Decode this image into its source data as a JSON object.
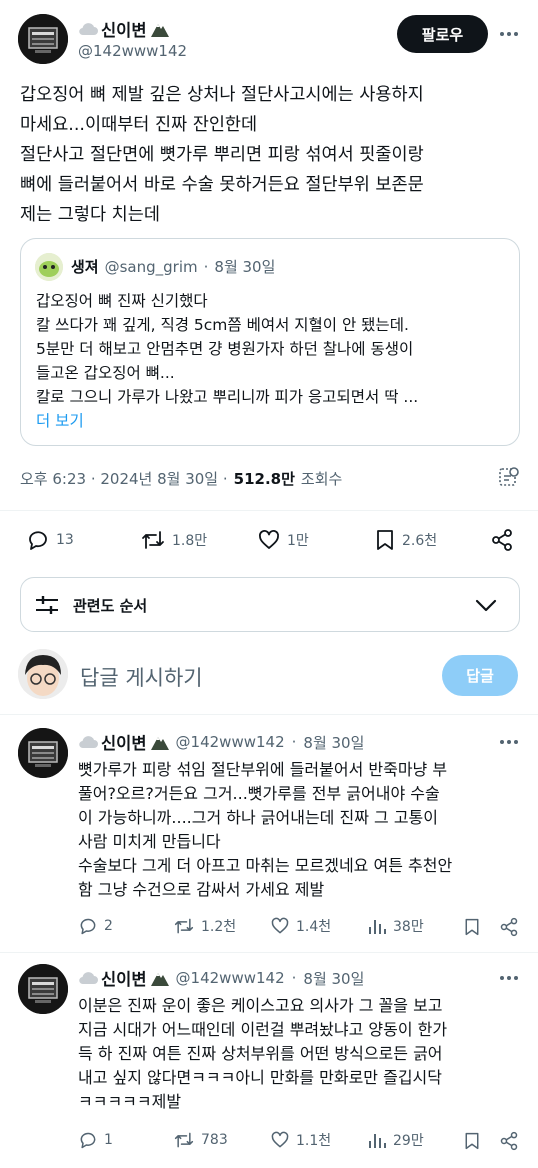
{
  "main_tweet": {
    "display_name": "신이변",
    "handle": "@142www142",
    "follow_label": "팔로우",
    "text_lines": [
      "갑오징어 뼈 제발 깊은 상처나 절단사고시에는 사용하지",
      "마세요...이때부터 진짜 잔인한데",
      "절단사고 절단면에 뼛가루 뿌리면 피랑 섞여서 핏줄이랑",
      "뼈에 들러붙어서 바로 수술 못하거든요 절단부위 보존문",
      "제는 그렇다 치는데"
    ],
    "quote": {
      "display_name": "생져",
      "handle": "@sang_grim",
      "dot": "·",
      "date": "8월 30일",
      "lines": [
        "갑오징어 뼈 진짜 신기했다",
        "칼 쓰다가 꽤 깊게, 직경 5cm쯤 베여서 지혈이 안 됐는데.",
        "5분만 더 해보고 안멈추면 걍 병원가자 하던 찰나에 동생이",
        "들고온 갑오징어 뼈...",
        "칼로 그으니 가루가 나왔고 뿌리니까 피가 응고되면서 딱 ..."
      ],
      "more_label": "더 보기"
    },
    "timestamp": "오후 6:23 · 2024년 8월 30일 ·",
    "views_count": "512.8만",
    "views_label": "조회수",
    "actions": {
      "replies": "13",
      "retweets": "1.8만",
      "likes": "1만",
      "bookmarks": "2.6천"
    }
  },
  "sort": {
    "label": "관련도 순서"
  },
  "reply_box": {
    "placeholder": "답글 게시하기",
    "button_label": "답글"
  },
  "replies": [
    {
      "display_name": "신이변",
      "handle": "@142www142",
      "dot": "·",
      "date": "8월 30일",
      "lines": [
        "뼛가루가 피랑 섞임 절단부위에 들러붙어서 반죽마냥 부",
        "풀어?오르?거든요 그거...뼛가루를 전부 긁어내야 수술",
        "이 가능하니까....그거 하나 긁어내는데 진짜 그 고통이",
        "사람 미치게 만듭니다",
        "수술보다 그게 더 아프고 마취는 모르겠네요 여튼 추천안",
        "함 그냥 수건으로 감싸서 가세요 제발"
      ],
      "actions": {
        "replies": "2",
        "retweets": "1.2천",
        "likes": "1.4천",
        "views": "38만"
      }
    },
    {
      "display_name": "신이변",
      "handle": "@142www142",
      "dot": "·",
      "date": "8월 30일",
      "lines": [
        "이분은 진짜 운이 좋은 케이스고요 의사가 그 꼴을 보고",
        "지금 시대가 어느때인데 이런걸 뿌려놨냐고 양동이 한가",
        "득 하 진짜 여튼 진짜 상처부위를 어떤 방식으로든 긁어",
        "내고 싶지 않다면ㅋㅋㅋ아니 만화를 만화로만 즐깁시닥",
        "ㅋㅋㅋㅋㅋ제발"
      ],
      "actions": {
        "replies": "1",
        "retweets": "783",
        "likes": "1.1천",
        "views": "29만"
      }
    }
  ],
  "colors": {
    "text": "#0f1419",
    "secondary": "#536471",
    "link": "#1d9bf0",
    "follow_bg": "#0f1419",
    "reply_button_bg": "#8ecdf8",
    "border": "#cfd9de"
  }
}
